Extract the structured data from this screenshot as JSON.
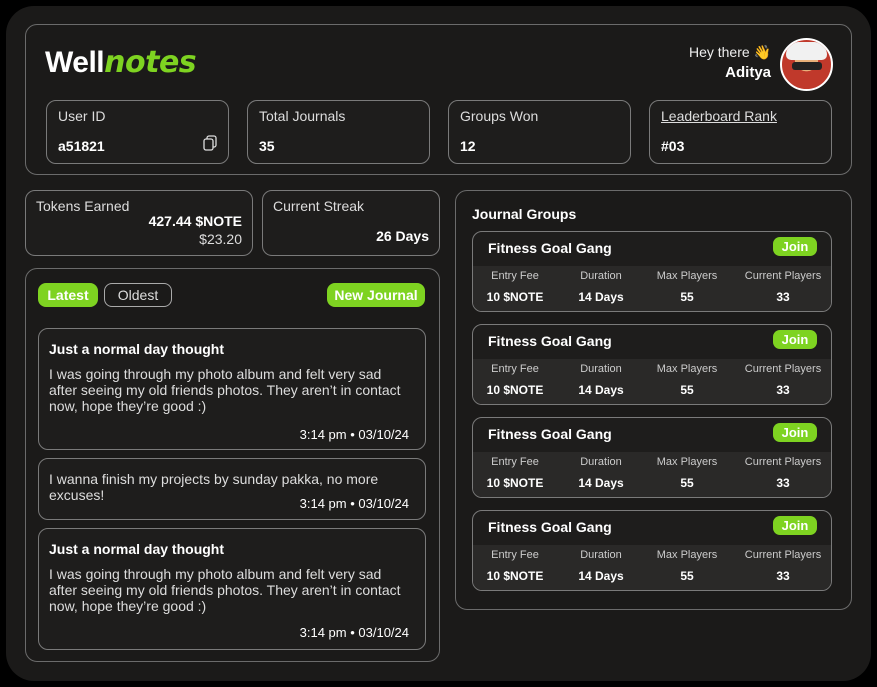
{
  "header": {
    "logo_part1": "Well",
    "logo_part2": "notes",
    "greeting": "Hey there 👋",
    "user_name": "Aditya"
  },
  "stats": [
    {
      "label": "User ID",
      "value": "a51821"
    },
    {
      "label": "Total Journals",
      "value": "35"
    },
    {
      "label": "Groups Won",
      "value": "12"
    },
    {
      "label": "Leaderboard Rank",
      "value": "#03"
    }
  ],
  "tokens": {
    "label": "Tokens Earned",
    "amount": "427.44 $NOTE",
    "usd": "$23.20"
  },
  "streak": {
    "label": "Current Streak",
    "value": "26 Days"
  },
  "journal_tabs": {
    "latest": "Latest",
    "oldest": "Oldest",
    "new_journal": "New Journal"
  },
  "journals": [
    {
      "title": "Just a normal day thought",
      "body": "I was going through my photo album and felt very sad after seeing my old friends photos. They aren’t in contact now, hope they’re good :)",
      "time": "3:14 pm • 03/10/24"
    },
    {
      "title": "",
      "body": "I wanna finish my projects by sunday pakka, no more excuses!",
      "time": "3:14 pm • 03/10/24"
    },
    {
      "title": "Just a normal day thought",
      "body": "I was going through my photo album and felt very sad after seeing my old friends photos. They aren’t in contact now, hope they’re good :)",
      "time": "3:14 pm • 03/10/24"
    }
  ],
  "groups_section": {
    "title": "Journal Groups"
  },
  "group_headers": {
    "entry_fee": "Entry Fee",
    "duration": "Duration",
    "max_players": "Max Players",
    "current_players": "Current Players"
  },
  "groups": [
    {
      "name": "Fitness Goal Gang",
      "join": "Join",
      "entry_fee": "10 $NOTE",
      "duration": "14 Days",
      "max_players": "55",
      "current_players": "33"
    },
    {
      "name": "Fitness Goal Gang",
      "join": "Join",
      "entry_fee": "10 $NOTE",
      "duration": "14 Days",
      "max_players": "55",
      "current_players": "33"
    },
    {
      "name": "Fitness Goal Gang",
      "join": "Join",
      "entry_fee": "10 $NOTE",
      "duration": "14 Days",
      "max_players": "55",
      "current_players": "33"
    },
    {
      "name": "Fitness Goal Gang",
      "join": "Join",
      "entry_fee": "10 $NOTE",
      "duration": "14 Days",
      "max_players": "55",
      "current_players": "33"
    }
  ],
  "colors": {
    "accent": "#7ed321",
    "background": "#1b1a19",
    "border": "#7a7a7a"
  }
}
